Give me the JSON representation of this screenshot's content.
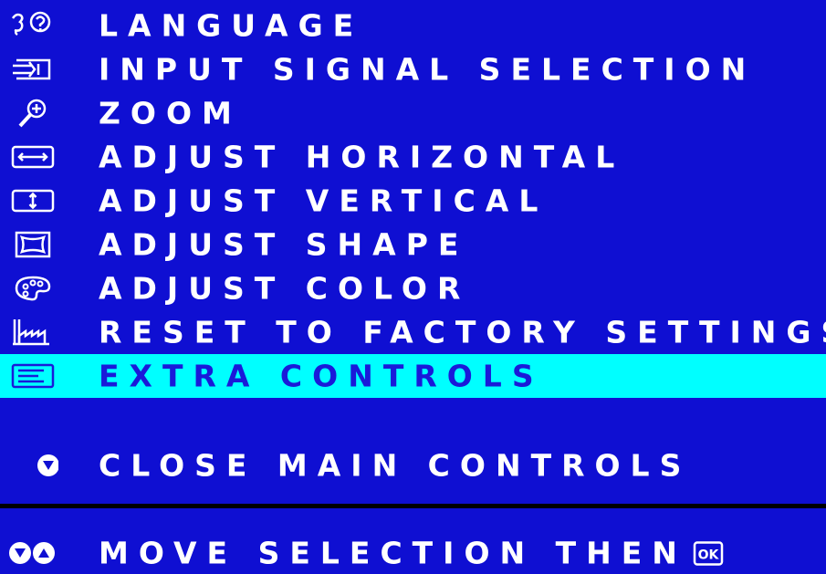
{
  "colors": {
    "background": "#0f0fd2",
    "selection_bar": "#00ffff",
    "selected_text": "#1a1ad9",
    "text": "#ffffff",
    "divider": "#000000"
  },
  "menu": {
    "items": [
      {
        "label": "LANGUAGE",
        "icon": "language-icon",
        "selected": false
      },
      {
        "label": "INPUT SIGNAL SELECTION",
        "icon": "input-signal-icon",
        "selected": false
      },
      {
        "label": "ZOOM",
        "icon": "zoom-icon",
        "selected": false
      },
      {
        "label": "ADJUST HORIZONTAL",
        "icon": "horizontal-arrows-icon",
        "selected": false
      },
      {
        "label": "ADJUST VERTICAL",
        "icon": "vertical-arrows-icon",
        "selected": false
      },
      {
        "label": "ADJUST SHAPE",
        "icon": "shape-icon",
        "selected": false
      },
      {
        "label": "ADJUST COLOR",
        "icon": "palette-icon",
        "selected": false
      },
      {
        "label": "RESET TO FACTORY SETTINGS",
        "icon": "factory-icon",
        "selected": false
      },
      {
        "label": "EXTRA CONTROLS",
        "icon": "extra-controls-icon",
        "selected": true
      }
    ]
  },
  "close": {
    "label": "CLOSE MAIN CONTROLS",
    "icon": "down-button-icon"
  },
  "footer": {
    "label": "MOVE SELECTION THEN",
    "icons": [
      "down-button-icon",
      "up-button-icon",
      "ok-button-icon"
    ]
  }
}
